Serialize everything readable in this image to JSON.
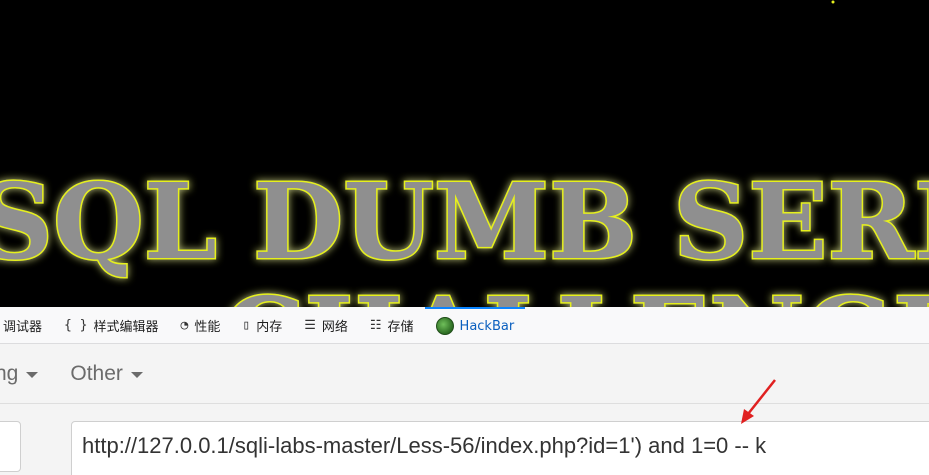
{
  "banner": {
    "line1": "SQL DUMB SERIES",
    "line2": "CHALLENGES"
  },
  "devtools": {
    "tabs": [
      {
        "label": "调试器",
        "icon": "debugger-icon",
        "glyph": ""
      },
      {
        "label": "样式编辑器",
        "icon": "style-editor-icon",
        "glyph": "{ }"
      },
      {
        "label": "性能",
        "icon": "performance-icon",
        "glyph": "◔"
      },
      {
        "label": "内存",
        "icon": "memory-icon",
        "glyph": "▯"
      },
      {
        "label": "网络",
        "icon": "network-icon",
        "glyph": "☰"
      },
      {
        "label": "存储",
        "icon": "storage-icon",
        "glyph": "☷"
      },
      {
        "label": "HackBar",
        "icon": "hackbar-icon",
        "glyph": ""
      }
    ],
    "active_tab": "HackBar",
    "accent_color": "#0a84ff"
  },
  "hackbar": {
    "menus": {
      "encoding": "ng",
      "other": "Other"
    },
    "url_value": "http://127.0.0.1/sqli-labs-master/Less-56/index.php?id=1') and 1=0 -- k"
  },
  "annotation": {
    "color": "#e02020",
    "icon": "arrow-icon"
  }
}
